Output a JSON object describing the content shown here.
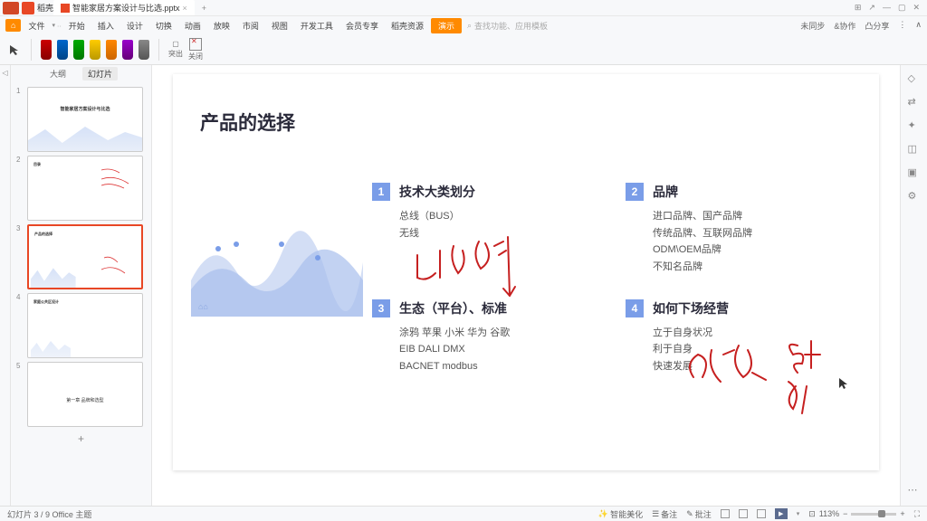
{
  "titlebar": {
    "app": "稻壳",
    "doc": "智能家居方案设计与比选.pptx"
  },
  "menubar": {
    "file": "文件",
    "items": [
      "开始",
      "插入",
      "设计",
      "切换",
      "动画",
      "放映",
      "市阅",
      "视图",
      "开发工具",
      "会员专享",
      "稻壳资源"
    ],
    "presenter": "演示",
    "search_ph": "查找功能、应用模板",
    "right": [
      "未同步",
      "&协作",
      "凸分享"
    ]
  },
  "toolbar": {
    "highlight": "突出",
    "close": "关闭"
  },
  "sidepanel": {
    "tab_outline": "大纲",
    "tab_slides": "幻灯片"
  },
  "thumbs": {
    "1": "智能家居方案设计与比选",
    "2": "目录",
    "3": "产品的选择",
    "4": "家庭公共区设计",
    "5": "第一章 品牌和选型"
  },
  "slide": {
    "title": "产品的选择",
    "items": [
      {
        "num": "1",
        "title": "技术大类划分",
        "lines": [
          "总线（BUS）",
          "无线"
        ]
      },
      {
        "num": "2",
        "title": "品牌",
        "lines": [
          "进口品牌、国产品牌",
          "传统品牌、互联网品牌",
          "ODM\\OEM品牌",
          "不知名品牌"
        ]
      },
      {
        "num": "3",
        "title": "生态（平台）、标准",
        "lines": [
          "涂鸦 苹果 小米 华为 谷歌",
          "EIB DALI DMX",
          "BACNET modbus"
        ]
      },
      {
        "num": "4",
        "title": "如何下场经营",
        "lines": [
          "立于自身状况",
          "利于自身",
          "快速发展"
        ]
      }
    ]
  },
  "statusbar": {
    "left": "幻灯片 3 / 9   Office 主题",
    "ai": "智能美化",
    "notes": "备注",
    "duplicate": "批注",
    "zoom": "113%"
  }
}
